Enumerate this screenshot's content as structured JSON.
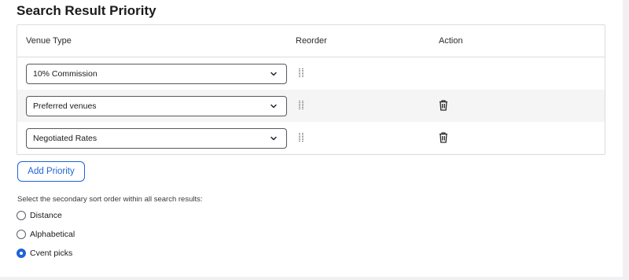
{
  "page": {
    "title": "Search Result Priority"
  },
  "table": {
    "headers": {
      "venue_type": "Venue Type",
      "reorder": "Reorder",
      "action": "Action"
    },
    "rows": [
      {
        "venue_type": "10% Commission",
        "deletable": false
      },
      {
        "venue_type": "Preferred venues",
        "deletable": true
      },
      {
        "venue_type": "Negotiated Rates",
        "deletable": true
      }
    ]
  },
  "add_priority_label": "Add Priority",
  "secondary_sort": {
    "label": "Select the secondary sort order within all search results:",
    "options": [
      {
        "label": "Distance",
        "selected": false
      },
      {
        "label": "Alphabetical",
        "selected": false
      },
      {
        "label": "Cvent picks",
        "selected": true
      }
    ]
  },
  "colors": {
    "accent": "#1f64d7",
    "border": "#dcdcdc",
    "row_shade": "#f5f5f5"
  },
  "icons": {
    "select": "chevron-down-icon",
    "reorder": "drag-handle-icon",
    "delete": "trash-icon"
  }
}
